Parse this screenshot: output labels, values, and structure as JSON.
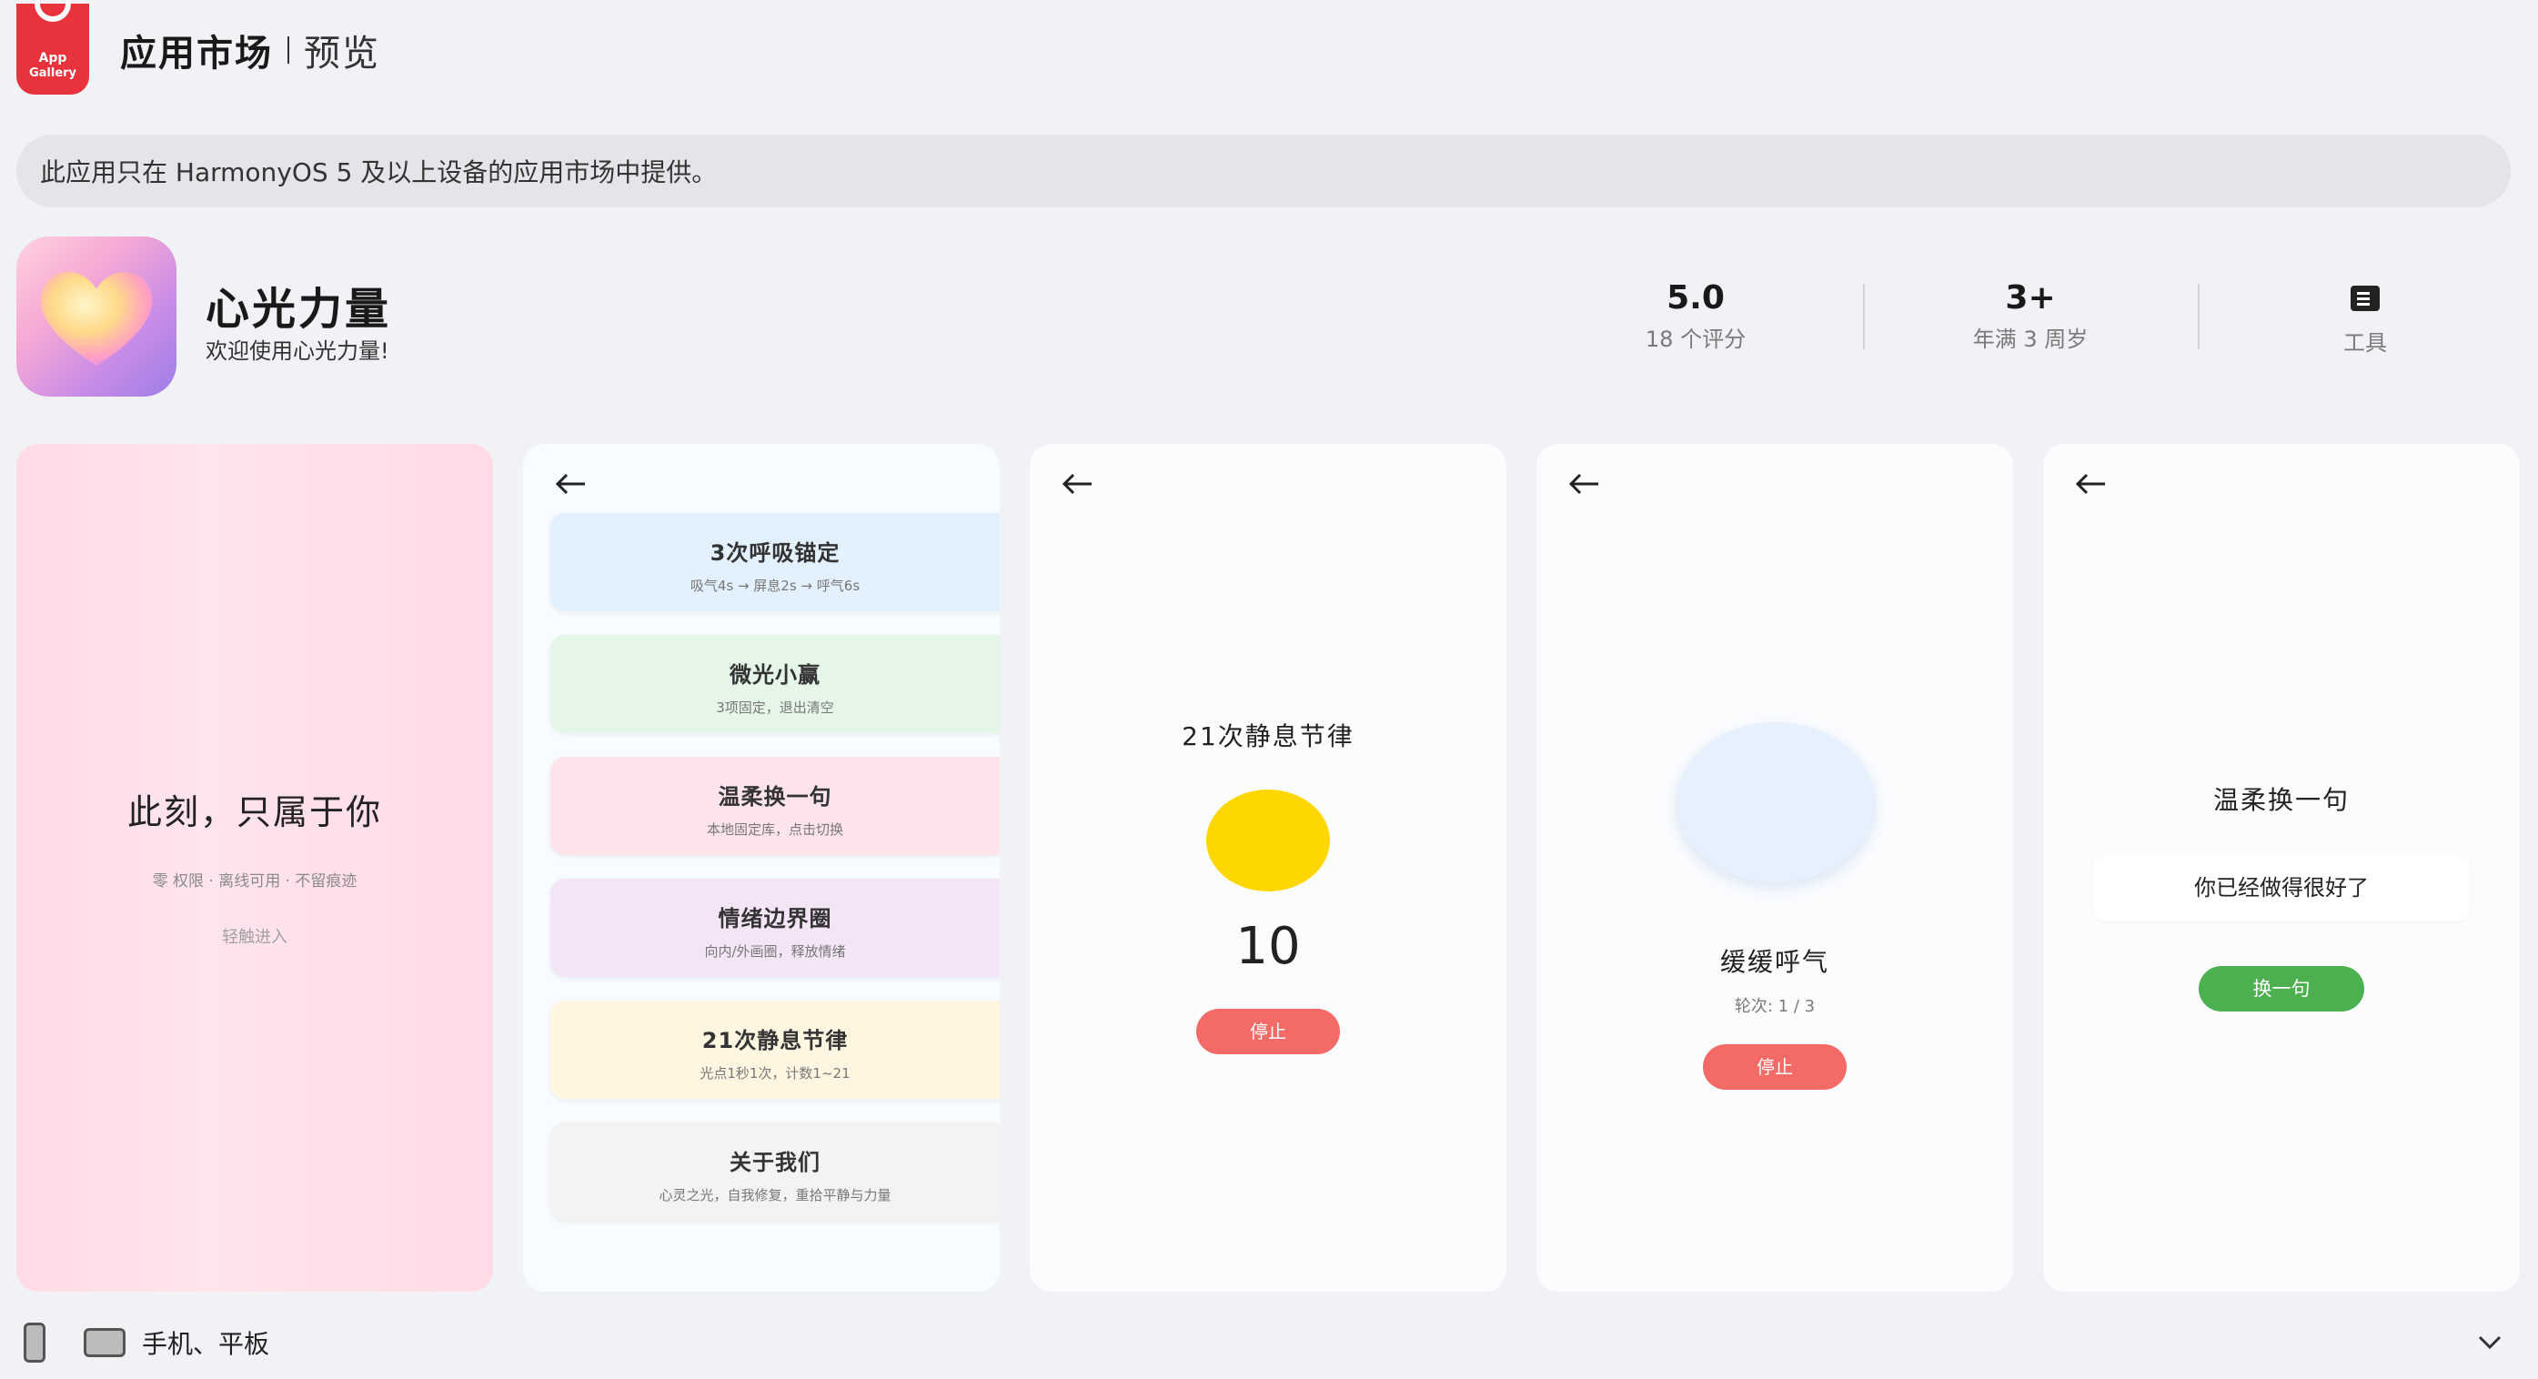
{
  "header": {
    "logo_line1": "App",
    "logo_line2": "Gallery",
    "brand": "应用市场",
    "section": "预览"
  },
  "notice": "此应用只在 HarmonyOS 5 及以上设备的应用市场中提供。",
  "app": {
    "name": "心光力量",
    "subtitle": "欢迎使用心光力量!",
    "icon": "heart-icon"
  },
  "stats": [
    {
      "value": "5.0",
      "label": "18 个评分"
    },
    {
      "value": "3+",
      "label": "年满 3 周岁"
    },
    {
      "icon": "tools-icon",
      "label": "工具"
    }
  ],
  "screenshots": {
    "s1": {
      "title": "此刻，只属于你",
      "subtitle": "零 权限 · 离线可用 · 不留痕迹",
      "enter": "轻触进入",
      "bg": "#ffdbe5"
    },
    "s2": {
      "cards": [
        {
          "title": "3次呼吸锚定",
          "sub": "吸气4s → 屏息2s → 呼气6s",
          "color": "#e3f0fd"
        },
        {
          "title": "微光小赢",
          "sub": "3项固定，退出清空",
          "color": "#e5f5e8"
        },
        {
          "title": "温柔换一句",
          "sub": "本地固定库，点击切换",
          "color": "#fde3ea"
        },
        {
          "title": "情绪边界圈",
          "sub": "向内/外画圈，释放情绪",
          "color": "#f3e4f6"
        },
        {
          "title": "21次静息节律",
          "sub": "光点1秒1次，计数1~21",
          "color": "#fef6e0"
        },
        {
          "title": "关于我们",
          "sub": "心灵之光，自我修复，重拾平静与力量",
          "color": "#f3f3f3"
        }
      ]
    },
    "s3": {
      "title": "21次静息节律",
      "count": "10",
      "stop": "停止",
      "dot_color": "#ffd700"
    },
    "s4": {
      "title": "缓缓呼气",
      "round": "轮次: 1 / 3",
      "stop": "停止"
    },
    "s5": {
      "title": "温柔换一句",
      "quote": "你已经做得很好了",
      "button": "换一句"
    }
  },
  "footer": {
    "devices": "手机、平板",
    "icons": [
      "phone-icon",
      "tablet-icon",
      "chevron-down-icon"
    ]
  },
  "colors": {
    "background": "#f1f2f5",
    "appgallery_red": "#e8333d",
    "stop_red": "#f36a66",
    "green_button": "#4caf50"
  }
}
